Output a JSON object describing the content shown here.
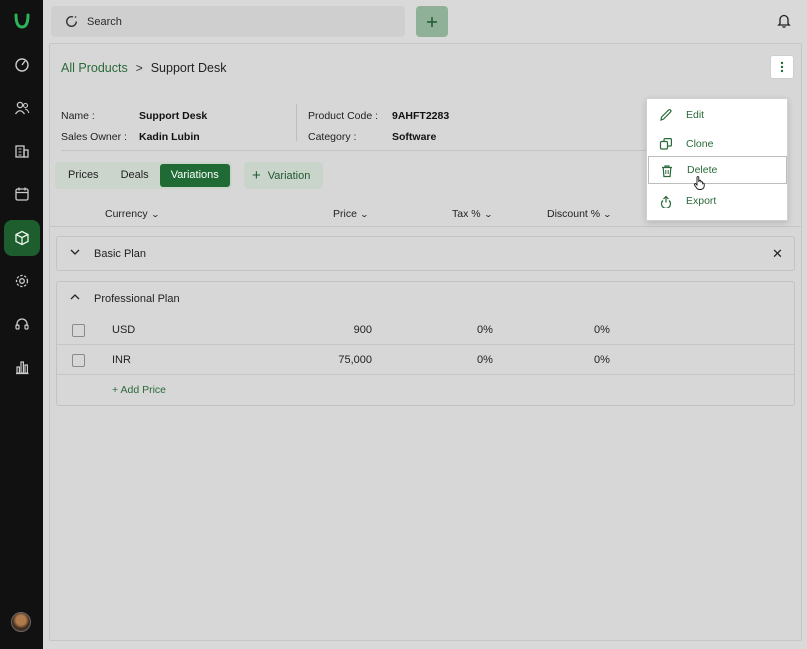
{
  "search": {
    "placeholder": "Search"
  },
  "breadcrumb": {
    "root": "All Products",
    "separator": ">",
    "current": "Support Desk"
  },
  "details": {
    "name_label": "Name :",
    "name_value": "Support Desk",
    "owner_label": "Sales Owner :",
    "owner_value": "Kadin Lubin",
    "code_label": "Product Code :",
    "code_value": "9AHFT2283",
    "category_label": "Category :",
    "category_value": "Software"
  },
  "tabs": [
    {
      "label": "Prices"
    },
    {
      "label": "Deals"
    },
    {
      "label": "Variations"
    }
  ],
  "active_tab": "Variations",
  "add_variation_label": "Variation",
  "table_headers": {
    "currency": "Currency",
    "price": "Price",
    "tax": "Tax %",
    "discount": "Discount %"
  },
  "plans": [
    {
      "name": "Basic Plan",
      "expanded": false
    },
    {
      "name": "Professional Plan",
      "expanded": true,
      "rows": [
        {
          "currency": "USD",
          "price": "900",
          "tax": "0%",
          "discount": "0%"
        },
        {
          "currency": "INR",
          "price": "75,000",
          "tax": "0%",
          "discount": "0%"
        }
      ],
      "add_price_label": "+ Add Price"
    }
  ],
  "menu": {
    "items": [
      {
        "label": "Edit",
        "icon": "pencil-icon"
      },
      {
        "label": "Clone",
        "icon": "clone-icon"
      },
      {
        "label": "Delete",
        "icon": "trash-icon"
      },
      {
        "label": "Export",
        "icon": "export-icon"
      }
    ],
    "hovered": "Delete"
  },
  "colors": {
    "accent": "#1f6a35",
    "sidebar": "#111111",
    "link": "#2b6a3a"
  }
}
